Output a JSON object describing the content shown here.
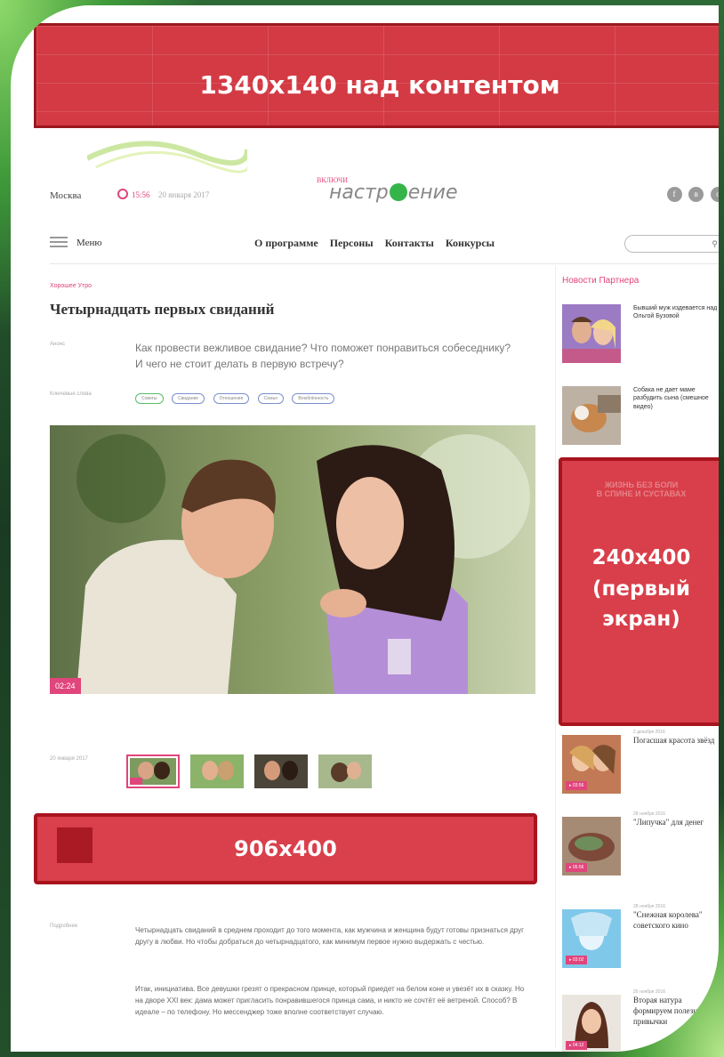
{
  "colors": {
    "accent": "#e0457b",
    "ad": "#d33a44",
    "logo_o": "#35b44a"
  },
  "ads": {
    "top_label": "1340x140 над контентом",
    "side_label_1": "240x400",
    "side_label_2": "(первый",
    "side_label_3": "экран)",
    "mid_label": "906x400"
  },
  "header": {
    "city": "Москва",
    "time": "15:56",
    "date": "20 января 2017",
    "logo_small": "ВКЛЮЧИ",
    "logo_left": "настр",
    "logo_right": "ение",
    "social": [
      "f",
      "в",
      "о"
    ]
  },
  "nav": {
    "menu": "Меню",
    "links": [
      "О программе",
      "Персоны",
      "Контакты",
      "Конкурсы"
    ],
    "search_icon": "search-icon"
  },
  "article": {
    "crumb": "Хорошее Утро",
    "title": "Четырнадцать первых свиданий",
    "lead_label": "Анонс",
    "lead": "Как провести вежливое свидание? Что поможет понравиться собеседнику? И чего не стоит делать в первую встречу?",
    "tags_label": "Ключевые слова",
    "tags": [
      "Советы",
      "Свидание",
      "Отношения",
      "Семья",
      "Влюблённость"
    ],
    "video_duration": "02:24",
    "thumbs_label": "20 января 2017",
    "text_label": "Подробнее",
    "paragraph_1": "Четырнадцать свиданий в среднем проходит до того момента, как мужчина и женщина будут готовы признаться друг другу в любви. Но чтобы добраться до четырнадцатого, как минимум первое нужно выдержать с честью.",
    "paragraph_2": "Итак, инициатива. Все девушки грезят о прекрасном принце, который приедет на белом коне и увезёт их в сказку. Но на дворе XXI век: дама может пригласить понравившегося принца сама, и никто не сочтёт её ветреной. Способ? В идеале – по телефону. Но мессенджер тоже вполне соответствует случаю."
  },
  "sidebar": {
    "title": "Новости Партнера",
    "items": [
      {
        "text": "Бывший муж издевается над Ольгой Бузовой"
      },
      {
        "text": "Собака не дает маме разбудить сына (смешное видео)"
      },
      {
        "date": "2 декабря 2016",
        "text": "Погасшая красота звёзд",
        "badge": "▸ 03:56"
      },
      {
        "date": "28 ноября 2016",
        "text": "\"Липучка\" для денег",
        "badge": "▸ 05:56"
      },
      {
        "date": "28 ноября 2016",
        "text": "\"Снежная королева\" советского кино",
        "badge": "▸ 03:02"
      },
      {
        "date": "26 ноября 2016",
        "text": "Вторая натура формируем полезные привычки",
        "badge": "▸ 04:12"
      }
    ]
  }
}
